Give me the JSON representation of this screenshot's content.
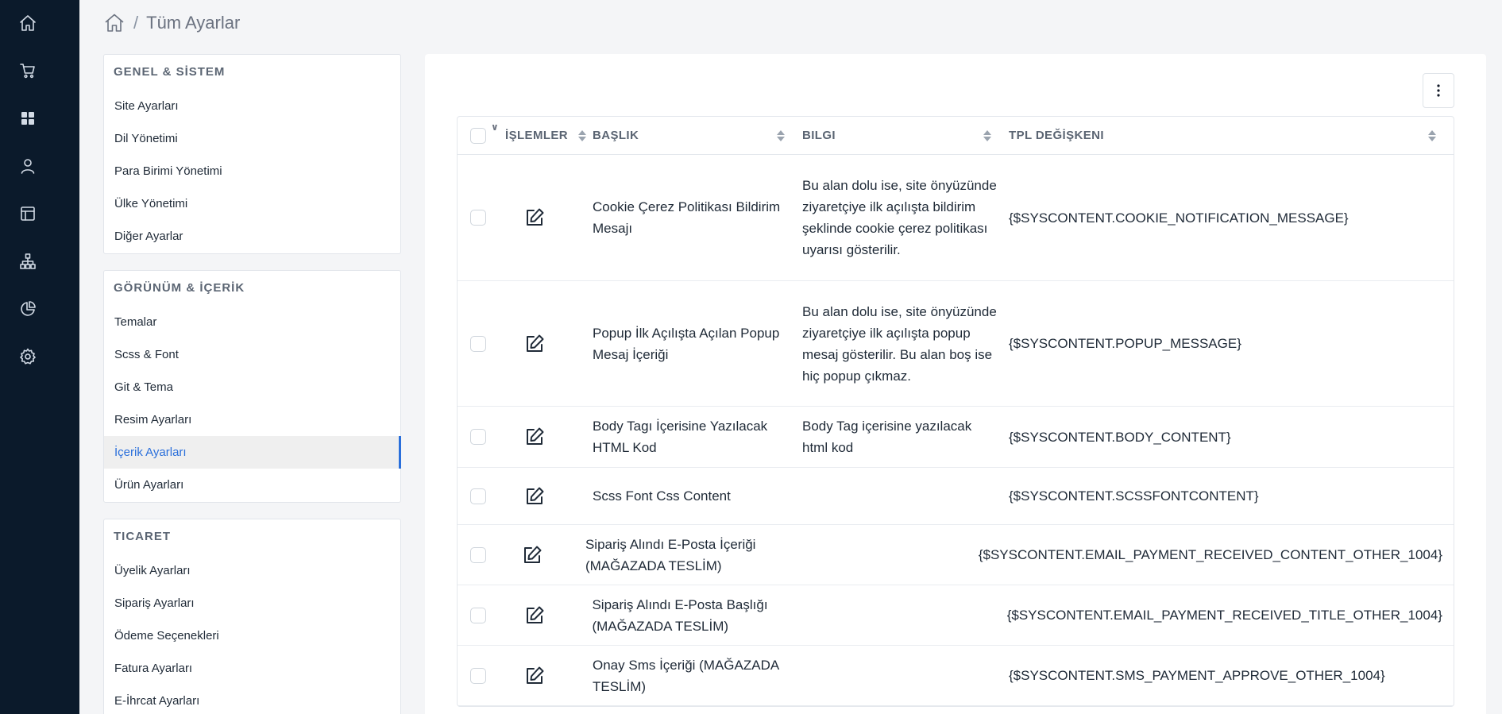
{
  "breadcrumb": {
    "current": "Tüm Ayarlar",
    "separator": "/"
  },
  "rail": [
    "home-icon",
    "cart-icon",
    "dashboard-icon",
    "user-icon",
    "layout-icon",
    "sitemap-icon",
    "pie-chart-icon",
    "gear-icon"
  ],
  "menu": {
    "general": {
      "title": "GENEL & SİSTEM",
      "items": [
        "Site Ayarları",
        "Dil Yönetimi",
        "Para Birimi Yönetimi",
        "Ülke Yönetimi",
        "Diğer Ayarlar"
      ]
    },
    "appearance": {
      "title": "GÖRÜNÜM & İÇERİK",
      "items": [
        "Temalar",
        "Scss & Font",
        "Git & Tema",
        "Resim Ayarları",
        "İçerik Ayarları",
        "Ürün Ayarları"
      ],
      "active": "İçerik Ayarları"
    },
    "commerce": {
      "title": "TICARET",
      "items": [
        "Üyelik Ayarları",
        "Sipariş Ayarları",
        "Ödeme Seçenekleri",
        "Fatura Ayarları",
        "E-İhrcat Ayarları"
      ]
    }
  },
  "table": {
    "headers": {
      "actions": "İŞLEMLER",
      "title": "BAŞLIK",
      "info": "BILGI",
      "tpl": "TPL DEĞİŞKENI"
    },
    "rows": [
      {
        "title": "Cookie Çerez Politikası Bildirim Mesajı",
        "info": "Bu alan dolu ise, site önyüzünde ziyaretçiye ilk açılışta bildirim şeklinde cookie çerez politikası uyarısı gösterilir.",
        "tpl": "{$SYSCONTENT.COOKIE_NOTIFICATION_MESSAGE}"
      },
      {
        "title": "Popup İlk Açılışta Açılan Popup Mesaj İçeriği",
        "info": "Bu alan dolu ise, site önyüzünde ziyaretçiye ilk açılışta popup mesaj gösterilir. Bu alan boş ise hiç popup çıkmaz.",
        "tpl": "{$SYSCONTENT.POPUP_MESSAGE}"
      },
      {
        "title": "Body Tagı İçerisine Yazılacak HTML Kod",
        "info": "Body Tag içerisine yazılacak html kod",
        "tpl": "{$SYSCONTENT.BODY_CONTENT}"
      },
      {
        "title": "Scss Font Css Content",
        "info": "",
        "tpl": "{$SYSCONTENT.SCSSFONTCONTENT}"
      },
      {
        "title": "Sipariş Alındı E-Posta İçeriği (MAĞAZADA TESLİM)",
        "info": "",
        "tpl": "{$SYSCONTENT.EMAIL_PAYMENT_RECEIVED_CONTENT_OTHER_1004}"
      },
      {
        "title": "Sipariş Alındı E-Posta Başlığı (MAĞAZADA TESLİM)",
        "info": "",
        "tpl": "{$SYSCONTENT.EMAIL_PAYMENT_RECEIVED_TITLE_OTHER_1004}"
      },
      {
        "title": "Onay Sms İçeriği (MAĞAZADA TESLİM)",
        "info": "",
        "tpl": "{$SYSCONTENT.SMS_PAYMENT_APPROVE_OTHER_1004}"
      }
    ]
  }
}
